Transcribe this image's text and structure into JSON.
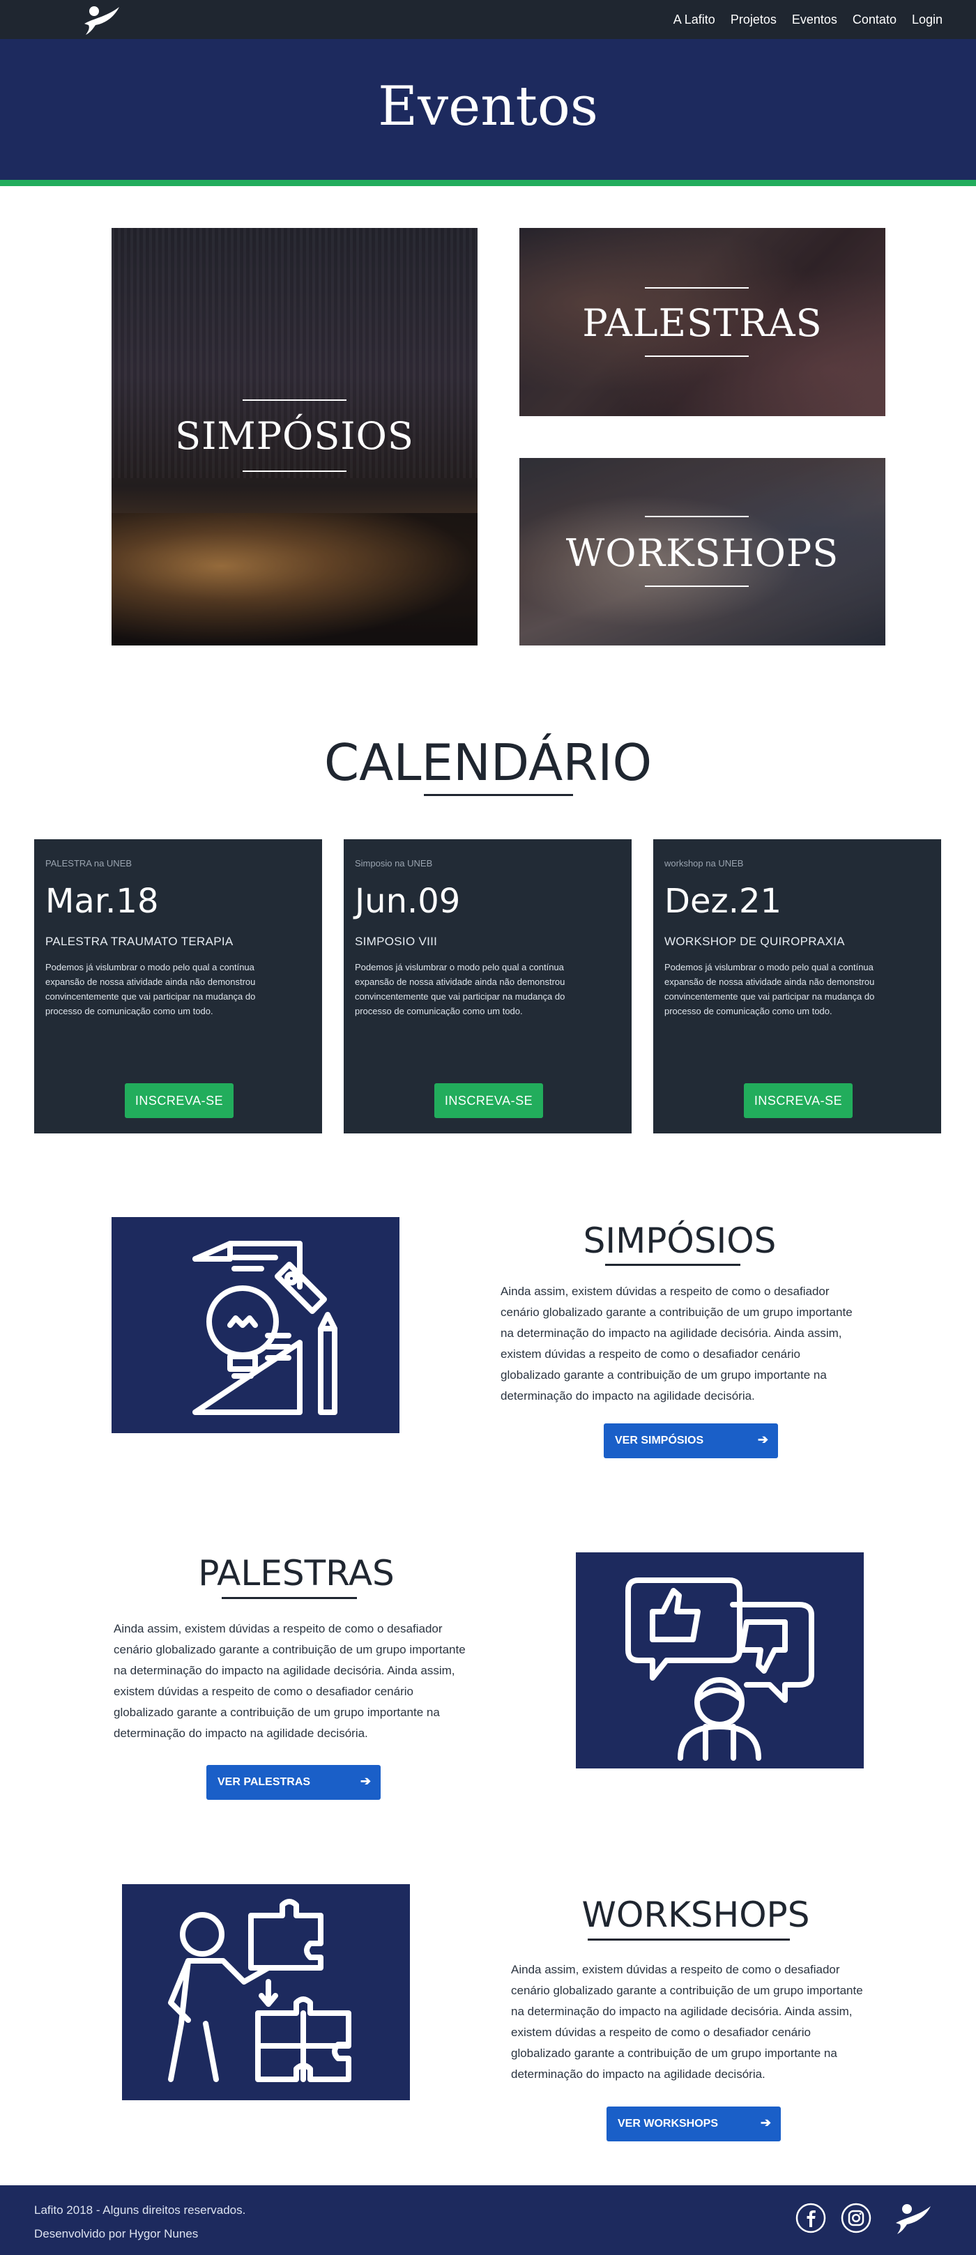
{
  "nav": {
    "links": [
      "A Lafito",
      "Projetos",
      "Eventos",
      "Contato",
      "Login"
    ]
  },
  "hero": {
    "title": "Eventos"
  },
  "tiles": {
    "simposios": "SIMPÓSIOS",
    "palestras": "PALESTRAS",
    "workshops": "WORKSHOPS"
  },
  "calendar": {
    "title": "CALENDÁRIO",
    "cards": [
      {
        "category": "PALESTRA na UNEB",
        "date": "Mar.18",
        "title": "PALESTRA TRAUMATO TERAPIA",
        "text": "Podemos já vislumbrar o modo pelo qual a contínua expansão de nossa atividade ainda não demonstrou convincentemente que vai participar na mudança do processo de comunicação como um todo.",
        "button": "INSCREVA-SE"
      },
      {
        "category": "Simposio na UNEB",
        "date": "Jun.09",
        "title": "SIMPOSIO VIII",
        "text": "Podemos já vislumbrar o modo pelo qual a contínua expansão de nossa atividade ainda não demonstrou convincentemente que vai participar na mudança do processo de comunicação como um todo.",
        "button": "INSCREVA-SE"
      },
      {
        "category": "workshop na UNEB",
        "date": "Dez.21",
        "title": "WORKSHOP DE QUIROPRAXIA",
        "text": "Podemos já vislumbrar o modo pelo qual a contínua expansão de nossa atividade ainda não demonstrou convincentemente que vai participar na mudança do processo de comunicação como um todo.",
        "button": "INSCREVA-SE"
      }
    ]
  },
  "features": {
    "simposios": {
      "title": "SIMPÓSIOS",
      "text": "Ainda assim, existem dúvidas a respeito de como o desafiador cenário globalizado garante a contribuição de um grupo importante na determinação do impacto na agilidade decisória. Ainda assim, existem dúvidas a respeito de como o desafiador cenário globalizado garante a contribuição de um grupo importante na determinação do impacto na agilidade decisória.",
      "button": "VER SIMPÓSIOS",
      "icon": "lightbulb-document-icon"
    },
    "palestras": {
      "title": "PALESTRAS",
      "text": "Ainda assim, existem dúvidas a respeito de como o desafiador cenário globalizado garante a contribuição de um grupo importante na determinação do impacto na agilidade decisória. Ainda assim, existem dúvidas a respeito de como o desafiador cenário globalizado garante a contribuição de um grupo importante na determinação do impacto na agilidade decisória.",
      "button": "VER PALESTRAS",
      "icon": "feedback-person-icon"
    },
    "workshops": {
      "title": "WORKSHOPS",
      "text": "Ainda assim, existem dúvidas a respeito de como o desafiador cenário globalizado garante a contribuição de um grupo importante na determinação do impacto na agilidade decisória. Ainda assim, existem dúvidas a respeito de como o desafiador cenário globalizado garante a contribuição de um grupo importante na determinação do impacto na agilidade decisória.",
      "button": "VER WORKSHOPS",
      "icon": "person-puzzle-icon"
    }
  },
  "footer": {
    "copyright": "Lafito 2018 - Alguns direitos reservados.",
    "developer": "Desenvolvido por Hygor Nunes",
    "icons": [
      "facebook-icon",
      "instagram-icon",
      "lafito-logo-icon"
    ]
  },
  "colors": {
    "navy": "#1d2a5e",
    "dark": "#1f2630",
    "card": "#222b36",
    "green": "#22ad5c",
    "blue": "#1a5fc8"
  }
}
